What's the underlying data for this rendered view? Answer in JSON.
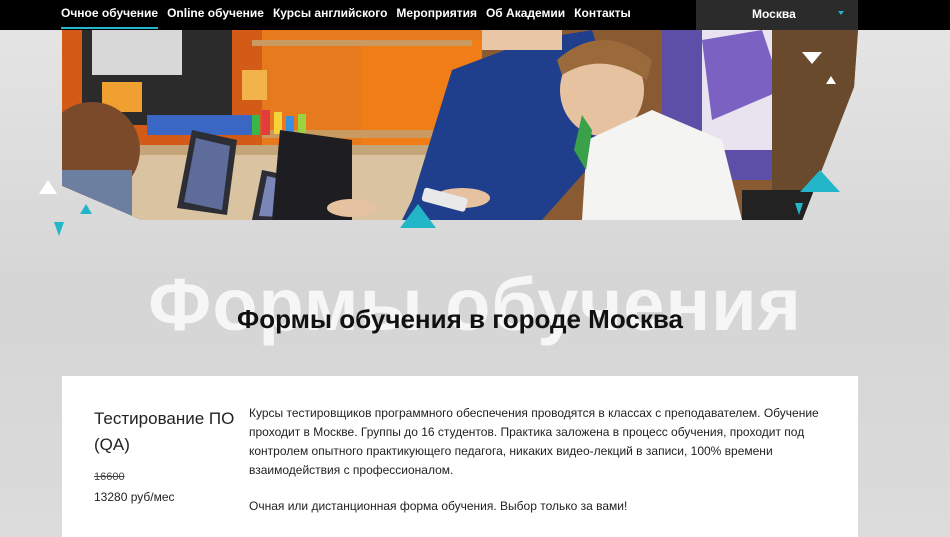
{
  "nav": {
    "items": [
      {
        "label": "Очное обучение",
        "active": true
      },
      {
        "label": "Online обучение",
        "active": false
      },
      {
        "label": "Курсы английского",
        "active": false
      },
      {
        "label": "Мероприятия",
        "active": false
      },
      {
        "label": "Об Академии",
        "active": false
      },
      {
        "label": "Контакты",
        "active": false
      }
    ],
    "city": "Москва"
  },
  "hero": {
    "image": "students-at-laptops-photo"
  },
  "section": {
    "watermark": "Формы обучения",
    "title": "Формы обучения в городе Москва"
  },
  "course": {
    "title": "Тестирование ПО (QA)",
    "old_price": "16600",
    "price": "13280 руб/мес",
    "description": "Курсы тестировщиков программного обеспечения проводятся в классах с преподавателем. Обучение проходит в Москве. Группы до 16 студентов. Практика заложена в процесс обучения, проходит под контролем опытного практикующего педагога, никаких видео-лекций в записи, 100% времени взаимодействия с профессионалом.",
    "note": "Очная или дистанционная форма обучения. Выбор только за вами!"
  },
  "colors": {
    "accent": "#23b5c8",
    "topbar": "#000000",
    "city_bg": "#2b2b2b"
  }
}
